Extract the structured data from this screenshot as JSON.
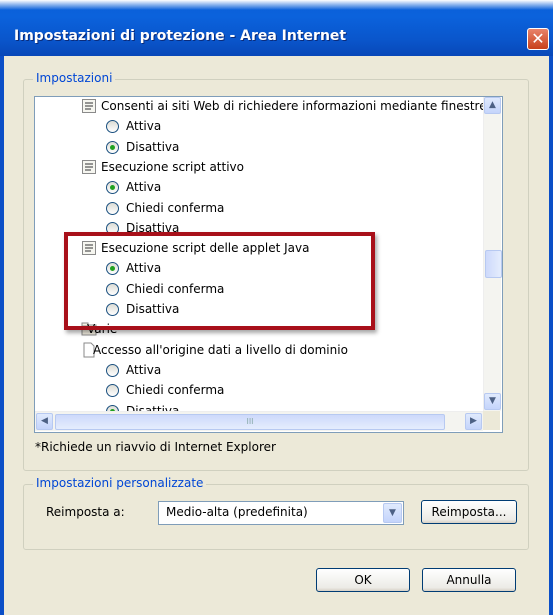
{
  "window": {
    "title": "Impostazioni di protezione - Area Internet",
    "close_glyph": "✕"
  },
  "settings_group": {
    "label": "Impostazioni"
  },
  "settings_list": [
    {
      "type": "category",
      "icon": "script-settings-icon",
      "label": "Consenti ai siti Web di richiedere informazioni mediante finestre d"
    },
    {
      "type": "radio",
      "label": "Attiva",
      "selected": false
    },
    {
      "type": "radio",
      "label": "Disattiva",
      "selected": true
    },
    {
      "type": "category",
      "icon": "script-settings-icon",
      "label": "Esecuzione script attivo"
    },
    {
      "type": "radio",
      "label": "Attiva",
      "selected": true
    },
    {
      "type": "radio",
      "label": "Chiedi conferma",
      "selected": false
    },
    {
      "type": "radio",
      "label": "Disattiva",
      "selected": false
    },
    {
      "type": "category",
      "icon": "script-settings-icon",
      "label": "Esecuzione script delle applet Java"
    },
    {
      "type": "radio",
      "label": "Attiva",
      "selected": true
    },
    {
      "type": "radio",
      "label": "Chiedi conferma",
      "selected": false
    },
    {
      "type": "radio",
      "label": "Disattiva",
      "selected": false
    },
    {
      "type": "category",
      "icon": "folder-icon",
      "label": "Varie"
    },
    {
      "type": "category",
      "icon": "document-icon",
      "label": "Accesso all'origine dati a livello di dominio"
    },
    {
      "type": "radio",
      "label": "Attiva",
      "selected": false
    },
    {
      "type": "radio",
      "label": "Chiedi conferma",
      "selected": false
    },
    {
      "type": "radio",
      "label": "Disattiva",
      "selected": true
    }
  ],
  "scrollbars": {
    "up": "▲",
    "down": "▼",
    "left": "◀",
    "right": "▶",
    "grip": "III"
  },
  "restart_note": "*Richiede un riavvio di Internet Explorer",
  "custom_group": {
    "label": "Impostazioni personalizzate",
    "reset_to_label": "Reimposta a:",
    "reset_level": "Medio-alta (predefinita)",
    "combo_arrow": "▼",
    "reset_button": "Reimposta..."
  },
  "footer": {
    "ok": "OK",
    "cancel": "Annulla"
  },
  "colors": {
    "title_bar": "#0a5fd8",
    "highlight_border": "#a8101a",
    "group_label": "#0046d5"
  }
}
